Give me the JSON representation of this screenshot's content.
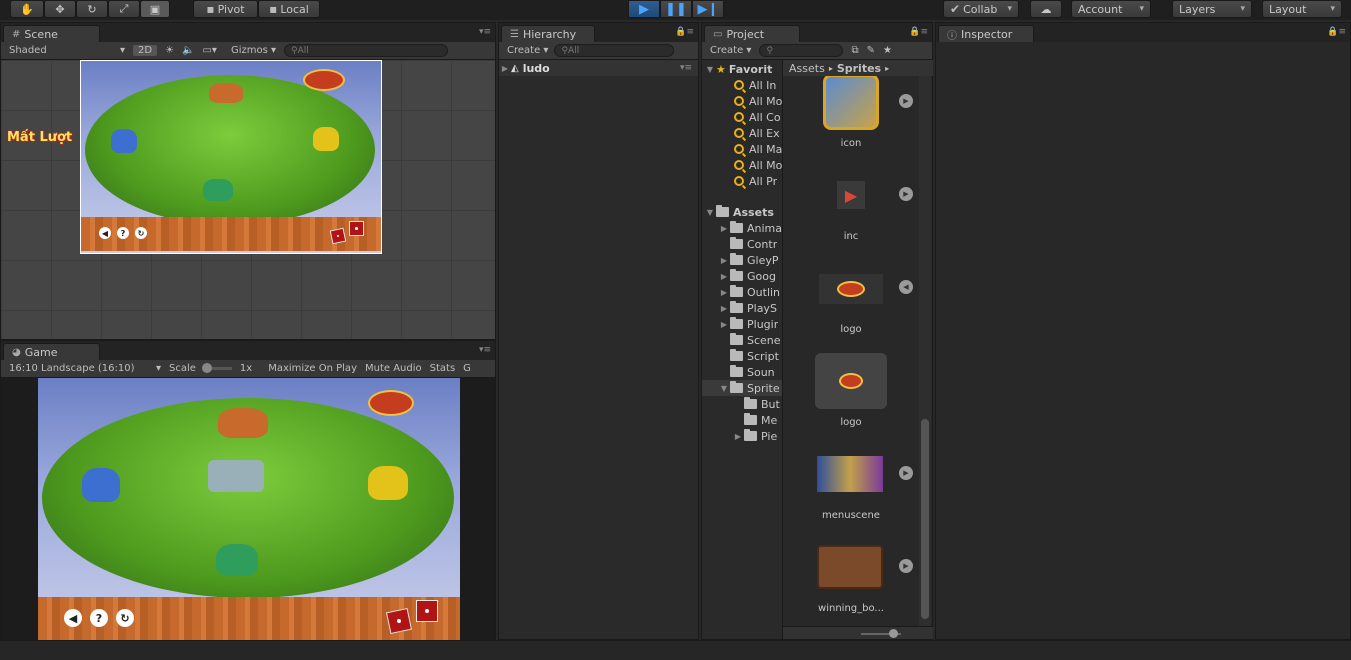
{
  "toolbar": {
    "pivot": "Pivot",
    "local": "Local",
    "collab": "Collab",
    "account": "Account",
    "layers": "Layers",
    "layout": "Layout"
  },
  "scene": {
    "tab": "Scene",
    "shading": "Shaded",
    "mode2d": "2D",
    "gizmos": "Gizmos",
    "search_placeholder": "All",
    "overlay_text": "Mất Lượt"
  },
  "game": {
    "tab": "Game",
    "aspect": "16:10 Landscape (16:10)",
    "scale_label": "Scale",
    "scale_value": "1x",
    "maximize": "Maximize On Play",
    "mute": "Mute Audio",
    "stats": "Stats",
    "gizmos_cut": "G"
  },
  "hierarchy": {
    "tab": "Hierarchy",
    "create": "Create",
    "search_placeholder": "All",
    "root": "ludo"
  },
  "project": {
    "tab": "Project",
    "create": "Create",
    "favorites": "Favorit",
    "favorite_items": [
      "All In",
      "All Mo",
      "All Co",
      "All Ex",
      "All Ma",
      "All Mo",
      "All Pr"
    ],
    "assets_root": "Assets",
    "folders": [
      {
        "name": "Anima",
        "arrow": true,
        "indent": 1
      },
      {
        "name": "Contr",
        "arrow": false,
        "indent": 1
      },
      {
        "name": "GleyP",
        "arrow": true,
        "indent": 1
      },
      {
        "name": "Goog",
        "arrow": true,
        "indent": 1
      },
      {
        "name": "Outlin",
        "arrow": true,
        "indent": 1
      },
      {
        "name": "PlayS",
        "arrow": true,
        "indent": 1
      },
      {
        "name": "Plugir",
        "arrow": true,
        "indent": 1
      },
      {
        "name": "Scene",
        "arrow": false,
        "indent": 1
      },
      {
        "name": "Script",
        "arrow": false,
        "indent": 1
      },
      {
        "name": "Soun",
        "arrow": false,
        "indent": 1
      },
      {
        "name": "Sprite",
        "arrow": true,
        "indent": 1,
        "open": true
      },
      {
        "name": "But",
        "arrow": false,
        "indent": 2
      },
      {
        "name": "Me",
        "arrow": false,
        "indent": 2
      },
      {
        "name": "Pie",
        "arrow": true,
        "indent": 2
      }
    ],
    "breadcrumb": [
      "Assets",
      "Sprites"
    ],
    "assets": [
      {
        "name": "icon"
      },
      {
        "name": "inc"
      },
      {
        "name": "logo"
      },
      {
        "name": "logo"
      },
      {
        "name": "menuscene"
      },
      {
        "name": "winning_bo..."
      }
    ]
  },
  "inspector": {
    "tab": "Inspector"
  },
  "colors": {
    "accent": "#4aa3ff",
    "panel": "#2a2a2a",
    "favorite_star": "#e8b020"
  }
}
